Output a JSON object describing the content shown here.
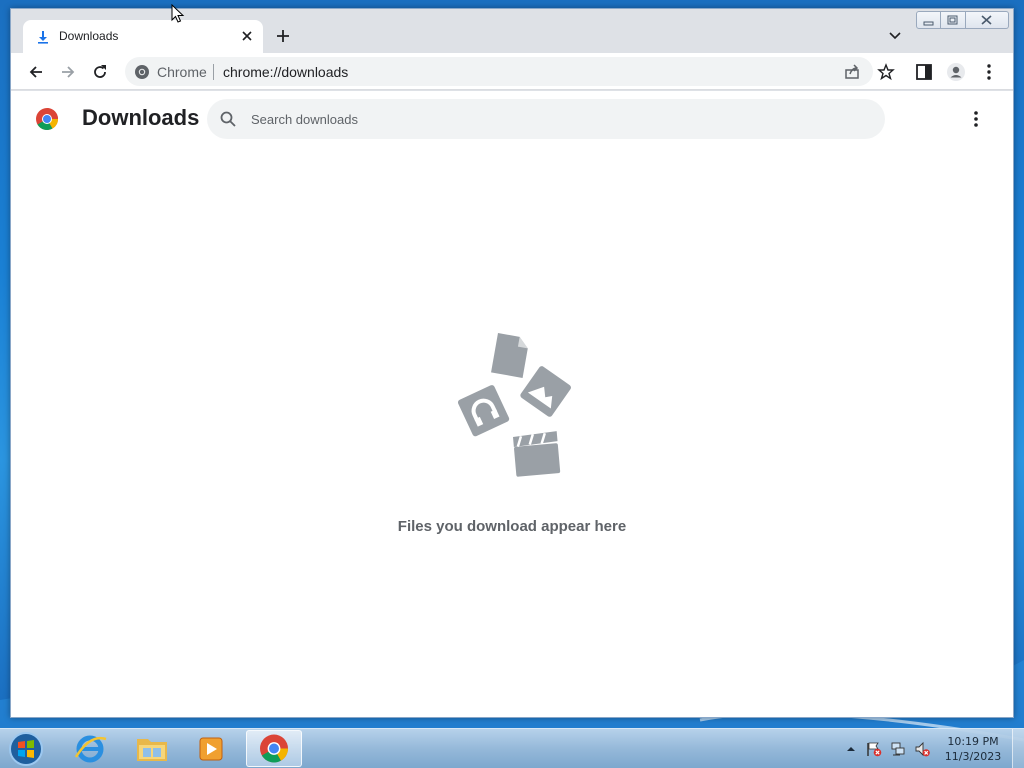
{
  "browser": {
    "tab": {
      "title": "Downloads"
    },
    "omnibox": {
      "chip": "Chrome",
      "url": "chrome://downloads"
    }
  },
  "page": {
    "title": "Downloads",
    "search_placeholder": "Search downloads",
    "empty_message": "Files you download appear here"
  },
  "taskbar": {
    "apps": [
      "internet-explorer",
      "file-explorer",
      "media-player",
      "chrome"
    ],
    "active_app": "chrome",
    "clock": {
      "time": "10:19 PM",
      "date": "11/3/2023"
    }
  },
  "colors": {
    "accent_blue": "#1a73e8",
    "text_primary": "#202124",
    "text_secondary": "#5f6368",
    "illustration_gray": "#9aa0a6"
  }
}
